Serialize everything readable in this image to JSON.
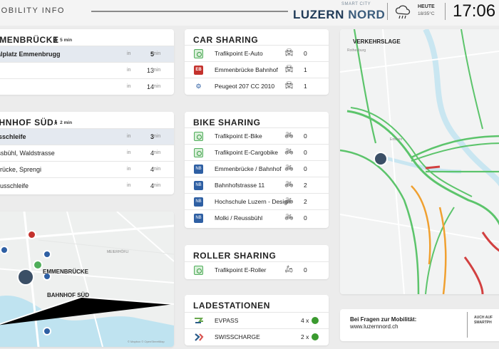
{
  "header": {
    "app_title": "MOBILITY INFO",
    "brand_top": "SMART CITY",
    "brand_name_a": "LUZERN",
    "brand_name_b": "NORD",
    "weather_label": "HEUTE",
    "weather_temp": "18/35°C",
    "clock": "17:06"
  },
  "departures": [
    {
      "station": "EMMENBRÜCKE",
      "walk": "5 min",
      "rows": [
        {
          "dest": "Gerliswilerstr / Seetalplatz Emmenbrugg",
          "in": "in",
          "mins": "5",
          "unit": "min"
        },
        {
          "dest": "",
          "in": "in",
          "mins": "13",
          "unit": "min"
        },
        {
          "dest": "",
          "in": "in",
          "mins": "14",
          "unit": "min"
        }
      ]
    },
    {
      "station": "BAHNHOF SÜD",
      "walk": "2 min",
      "rows": [
        {
          "dest": "Busschleife",
          "in": "in",
          "mins": "3",
          "unit": "min"
        },
        {
          "dest": "Reussbühl, Waldstrasse",
          "in": "in",
          "mins": "4",
          "unit": "min"
        },
        {
          "dest": "Emmenbrücke, Sprengi",
          "in": "in",
          "mins": "4",
          "unit": "min"
        },
        {
          "dest": "Busschleife",
          "in": "in",
          "mins": "4",
          "unit": "min"
        }
      ]
    }
  ],
  "car_sharing": {
    "title": "CAR SHARING",
    "rows": [
      {
        "logo": "green",
        "logo_text": "",
        "name": "Trafikpoint E-Auto",
        "vehicle_icon": "car-icon",
        "count": "0"
      },
      {
        "logo": "red",
        "logo_text": "EB",
        "name": "Emmenbrücke Bahnhof",
        "vehicle_icon": "car-icon",
        "count": "1"
      },
      {
        "logo": "plain",
        "logo_text": "⚙",
        "name": "Peugeot 207 CC 2010",
        "vehicle_icon": "car-icon",
        "count": "1"
      }
    ]
  },
  "bike_sharing": {
    "title": "BIKE SHARING",
    "rows": [
      {
        "logo": "green",
        "logo_text": "",
        "name": "Trafikpoint E-Bike",
        "count": "0"
      },
      {
        "logo": "green",
        "logo_text": "",
        "name": "Trafikpoint E-Cargobike",
        "count": "0"
      },
      {
        "logo": "blue",
        "logo_text": "NB",
        "name": "Emmenbrücke / Bahnhof",
        "count": "0"
      },
      {
        "logo": "blue",
        "logo_text": "NB",
        "name": "Bahnhofstrasse 11",
        "count": "2"
      },
      {
        "logo": "blue",
        "logo_text": "NB",
        "name": "Hochschule Luzern - Design",
        "count": "2"
      },
      {
        "logo": "blue",
        "logo_text": "NB",
        "name": "Molki / Reussbühl",
        "count": "0"
      }
    ]
  },
  "roller_sharing": {
    "title": "ROLLER SHARING",
    "rows": [
      {
        "logo": "green",
        "logo_text": "",
        "name": "Trafikpoint E-Roller",
        "count": "0"
      }
    ]
  },
  "charging": {
    "title": "LADESTATIONEN",
    "rows": [
      {
        "logo": "evpass",
        "name": "EVPASS",
        "count": "4 x",
        "status_color": "#3a9a2f"
      },
      {
        "logo": "swisscharge",
        "name": "SWISSCHARGE",
        "count": "2 x",
        "status_color": "#3a9a2f"
      }
    ]
  },
  "local_map": {
    "labels": {
      "emmenbruecke": "EMMENBRÜCKE",
      "bahnhof_sued": "BAHNHOF SÜD",
      "district": "MEIERHÖFLI"
    },
    "attribution": "© Mapbox © OpenStreetMap"
  },
  "traffic": {
    "title": "VERKEHRSLAGE",
    "place_a": "Emmen",
    "place_b": "Rothenburg"
  },
  "info": {
    "question": "Bei Fragen zur Mobilität:",
    "website": "www.luzernnord.ch",
    "side_line1": "AUCH AUF",
    "side_line2": "SMARTPH"
  },
  "colors": {
    "card_bg": "#ffffff",
    "page_bg": "#ececec",
    "highlight_row": "#e4e9f0",
    "brand_navy": "#1f3a57",
    "status_green": "#3a9a2f",
    "traffic_green": "#5cc46b",
    "traffic_orange": "#f0a030",
    "traffic_red": "#d24040"
  }
}
